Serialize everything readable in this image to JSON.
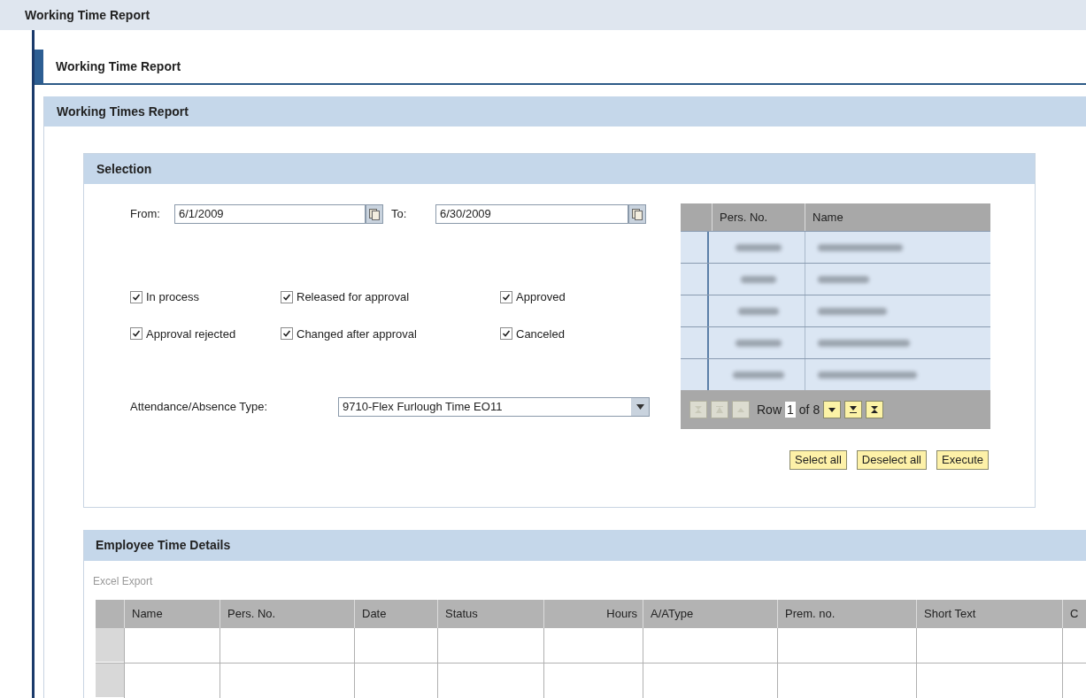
{
  "page_title": "Working Time Report",
  "section_title": "Working Time Report",
  "panel_title": "Working Times Report",
  "selection": {
    "title": "Selection",
    "from": {
      "label": "From:",
      "value": "6/1/2009"
    },
    "to": {
      "label": "To:",
      "value": "6/30/2009"
    },
    "statuses": [
      {
        "label": "In process",
        "checked": true
      },
      {
        "label": "Released for approval",
        "checked": true
      },
      {
        "label": "Approved",
        "checked": true
      },
      {
        "label": "Approval rejected",
        "checked": true
      },
      {
        "label": "Changed after approval",
        "checked": true
      },
      {
        "label": "Canceled",
        "checked": true
      }
    ],
    "absence_type": {
      "label": "Attendance/Absence Type:",
      "value": "9710-Flex Furlough Time EO11"
    },
    "person_table": {
      "columns": [
        "Pers. No.",
        "Name"
      ],
      "rows": [
        {
          "selected": false
        },
        {
          "selected": false
        },
        {
          "selected": false
        },
        {
          "selected": false
        },
        {
          "selected": false
        }
      ],
      "pager": {
        "label": "Row",
        "value": "1",
        "total": "of 8"
      }
    },
    "buttons": [
      "Select all",
      "Deselect all",
      "Execute"
    ]
  },
  "details": {
    "title": "Employee Time Details",
    "export_link": "Excel Export",
    "columns": [
      {
        "label": "Name",
        "kind": "text"
      },
      {
        "label": "Pers. No.",
        "kind": "text"
      },
      {
        "label": "Date",
        "kind": "text"
      },
      {
        "label": "Status",
        "kind": "text"
      },
      {
        "label": "Hours",
        "kind": "number"
      },
      {
        "label": "A/AType",
        "kind": "text"
      },
      {
        "label": "Prem. no.",
        "kind": "text"
      },
      {
        "label": "Short Text",
        "kind": "text"
      },
      {
        "label": "C",
        "kind": "text"
      }
    ],
    "rows": [
      {
        "selected": false
      },
      {
        "selected": false
      }
    ]
  }
}
